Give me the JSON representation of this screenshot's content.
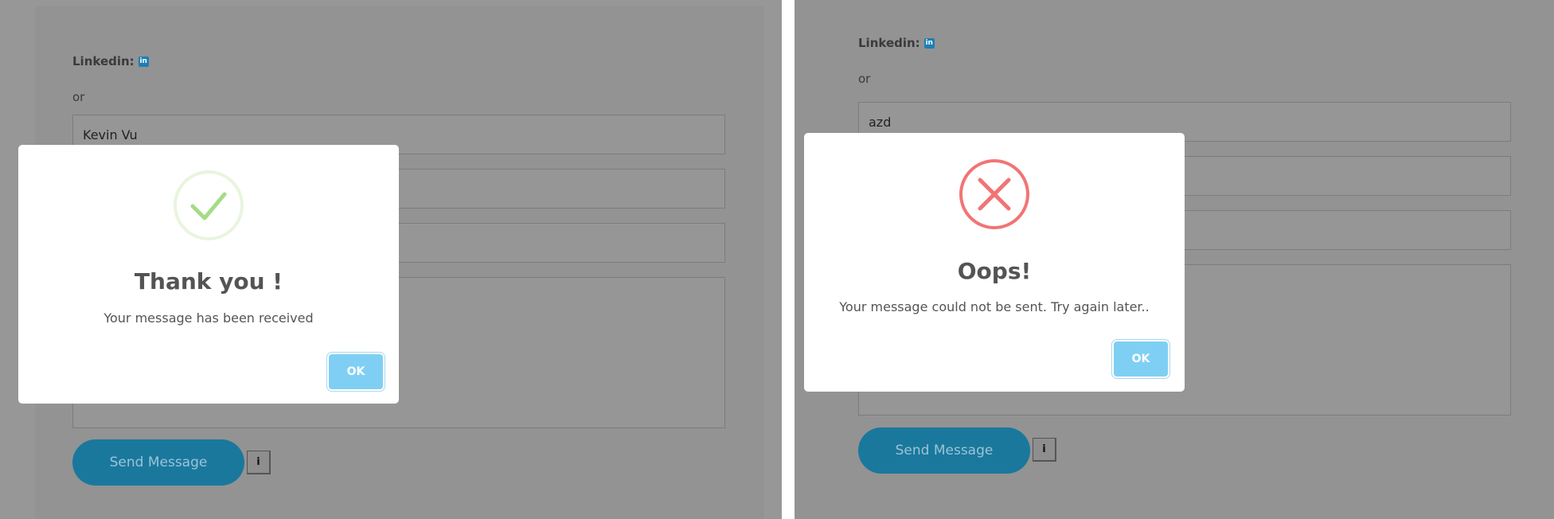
{
  "left": {
    "linkedin_label": "Linkedin:",
    "linkedin_icon_text": "in",
    "or_text": "or",
    "name_value": "Kevin Vu",
    "send_label": "Send Message",
    "info_icon_text": "i",
    "modal": {
      "icon": "check-icon",
      "title": "Thank you !",
      "message": "Your message has been received",
      "ok_label": "OK"
    }
  },
  "right": {
    "linkedin_label": "Linkedin:",
    "linkedin_icon_text": "in",
    "or_text": "or",
    "name_value": "azd",
    "send_label": "Send Message",
    "info_icon_text": "i",
    "modal": {
      "icon": "error-x-icon",
      "title": "Oops!",
      "message": "Your message could not be sent. Try again later..",
      "ok_label": "OK"
    }
  },
  "colors": {
    "overlay": "#979797",
    "send_button": "#1a789d",
    "ok_button": "#7fcff4",
    "success": "#a5dc86",
    "error": "#f27474",
    "linkedin": "#1e7fb4"
  }
}
